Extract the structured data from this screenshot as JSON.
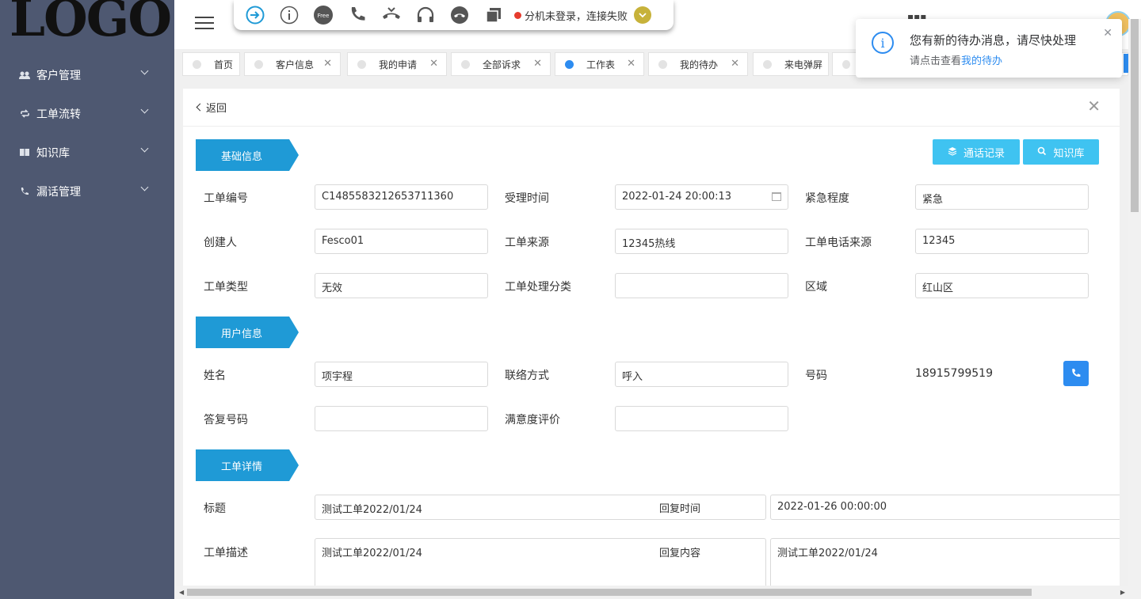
{
  "logo": "LOGO",
  "sidebar": {
    "items": [
      {
        "label": "客户管理",
        "icon": "users-icon"
      },
      {
        "label": "工单流转",
        "icon": "refresh-icon"
      },
      {
        "label": "知识库",
        "icon": "book-icon"
      },
      {
        "label": "漏话管理",
        "icon": "phone-icon"
      }
    ]
  },
  "phonebar": {
    "status": "分机未登录，连接失败",
    "free_badge": "Free"
  },
  "tabs": [
    {
      "label": "首页",
      "active": false,
      "closable": false
    },
    {
      "label": "客户信息",
      "active": false,
      "closable": true
    },
    {
      "label": "我的申请",
      "active": false,
      "closable": true
    },
    {
      "label": "全部诉求",
      "active": false,
      "closable": true
    },
    {
      "label": "工作表",
      "active": true,
      "closable": true
    },
    {
      "label": "我的待办",
      "active": false,
      "closable": true
    },
    {
      "label": "来电弹屏",
      "active": false,
      "closable": false
    }
  ],
  "notification": {
    "title": "您有新的待办消息，请尽快处理",
    "desc_prefix": "请点击查看",
    "desc_link": "我的待办"
  },
  "panel": {
    "back": "返回",
    "buttons": {
      "call_records": "通话记录",
      "knowledge": "知识库"
    },
    "sections": {
      "basic": "基础信息",
      "user": "用户信息",
      "detail": "工单详情"
    },
    "basic": {
      "order_no_label": "工单编号",
      "order_no": "C1485583212653711360",
      "accept_time_label": "受理时间",
      "accept_time": "2022-01-24 20:00:13",
      "urgency_label": "紧急程度",
      "urgency": "紧急",
      "creator_label": "创建人",
      "creator": "Fesco01",
      "source_label": "工单来源",
      "source": "12345热线",
      "phone_source_label": "工单电话来源",
      "phone_source": "12345",
      "type_label": "工单类型",
      "type": "无效",
      "category_label": "工单处理分类",
      "category": "",
      "region_label": "区域",
      "region": "红山区"
    },
    "user": {
      "name_label": "姓名",
      "name": "项宇程",
      "contact_label": "联络方式",
      "contact": "呼入",
      "number_label": "号码",
      "number": "18915799519",
      "reply_no_label": "答复号码",
      "reply_no": "",
      "satisfaction_label": "满意度评价",
      "satisfaction": ""
    },
    "detail": {
      "title_label": "标题",
      "title": "测试工单2022/01/24",
      "reply_time_label": "回复时间",
      "reply_time": "2022-01-26 00:00:00",
      "desc_label": "工单描述",
      "desc": "测试工单2022/01/24",
      "reply_content_label": "回复内容",
      "reply_content": "测试工单2022/01/24"
    }
  },
  "colors": {
    "sidebar_bg": "#4e5871",
    "section_tag": "#1f9ad6",
    "btn_light_blue": "#3fc3f1",
    "primary": "#2d8cf0"
  }
}
